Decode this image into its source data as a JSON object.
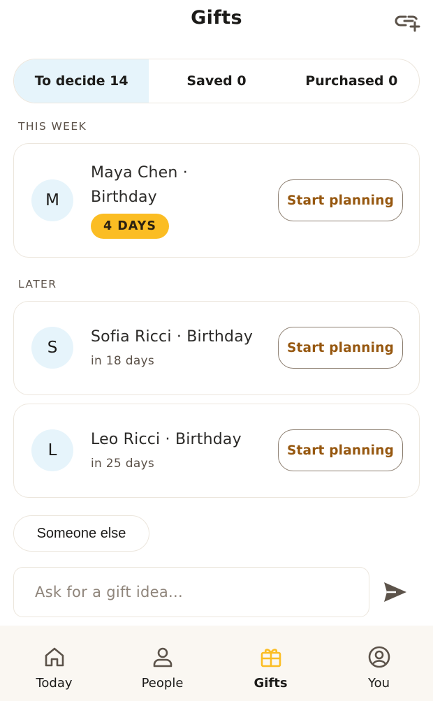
{
  "header": {
    "title": "Gifts",
    "add_icon": "link-add-icon"
  },
  "tabs": [
    {
      "label": "To decide 14",
      "active": true
    },
    {
      "label": "Saved 0",
      "active": false
    },
    {
      "label": "Purchased 0",
      "active": false
    }
  ],
  "sections": {
    "this_week": "THIS WEEK",
    "later": "LATER"
  },
  "cards": [
    {
      "initial": "M",
      "name": "Maya Chen ·",
      "name2": "Birthday",
      "badge": "4 DAYS",
      "button": "Start planning"
    },
    {
      "initial": "S",
      "name": "Sofia Ricci · Birthday",
      "sub": "in 18 days",
      "button": "Start planning"
    },
    {
      "initial": "L",
      "name": "Leo Ricci · Birthday",
      "sub": "in 25 days",
      "button": "Start planning"
    }
  ],
  "chip": {
    "label": "Someone else"
  },
  "ask": {
    "placeholder": "Ask for a gift idea..."
  },
  "nav": [
    {
      "label": "Today",
      "icon": "home-icon",
      "active": false
    },
    {
      "label": "People",
      "icon": "person-icon",
      "active": false
    },
    {
      "label": "Gifts",
      "icon": "gift-icon",
      "active": true
    },
    {
      "label": "You",
      "icon": "profile-icon",
      "active": false
    }
  ],
  "colors": {
    "accent": "#fbbd23",
    "active_tab_bg": "#e6f4fb",
    "button_text": "#96570f",
    "nav_bg": "#faf7f2"
  }
}
